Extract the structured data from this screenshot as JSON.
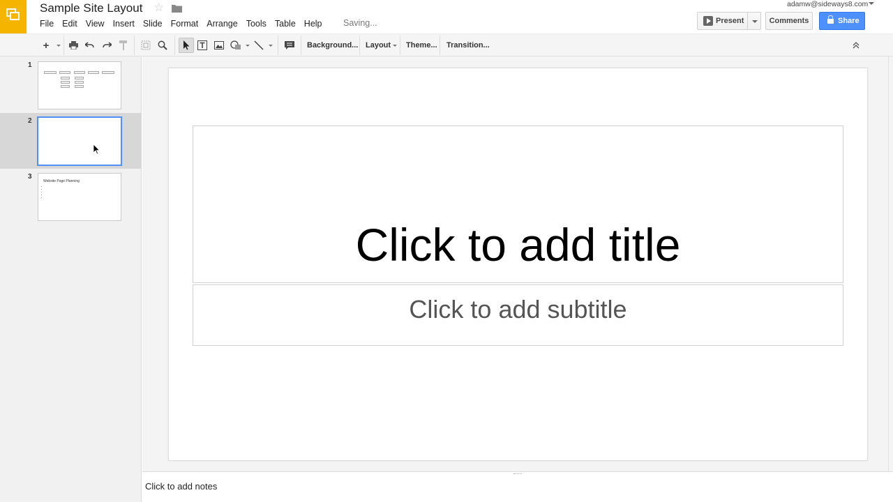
{
  "header": {
    "doc_title": "Sample Site Layout",
    "menu": [
      "File",
      "Edit",
      "View",
      "Insert",
      "Slide",
      "Format",
      "Arrange",
      "Tools",
      "Table",
      "Help"
    ],
    "saving_status": "Saving...",
    "account_email": "adamw@sideways8.com",
    "present_label": "Present",
    "comments_label": "Comments",
    "share_label": "Share"
  },
  "toolbar": {
    "background_label": "Background...",
    "layout_label": "Layout",
    "theme_label": "Theme...",
    "transition_label": "Transition...",
    "icons": [
      "plus-icon",
      "print-icon",
      "undo-icon",
      "redo-icon",
      "paint-format-icon",
      "zoom-fit-icon",
      "zoom-icon",
      "select-icon",
      "textbox-icon",
      "image-icon",
      "shape-icon",
      "line-icon",
      "comment-icon",
      "collapse-icon"
    ]
  },
  "filmstrip": {
    "slides": [
      {
        "number": "1",
        "type": "site-map"
      },
      {
        "number": "2",
        "type": "blank",
        "selected": true
      },
      {
        "number": "3",
        "type": "bullets",
        "title": "Website Page Planning"
      }
    ]
  },
  "slide": {
    "title_placeholder": "Click to add title",
    "subtitle_placeholder": "Click to add subtitle"
  },
  "notes": {
    "placeholder": "Click to add notes"
  },
  "colors": {
    "brand_yellow": "#f4b400",
    "share_blue": "#4d90fe",
    "selection_blue": "#4d90fe"
  }
}
